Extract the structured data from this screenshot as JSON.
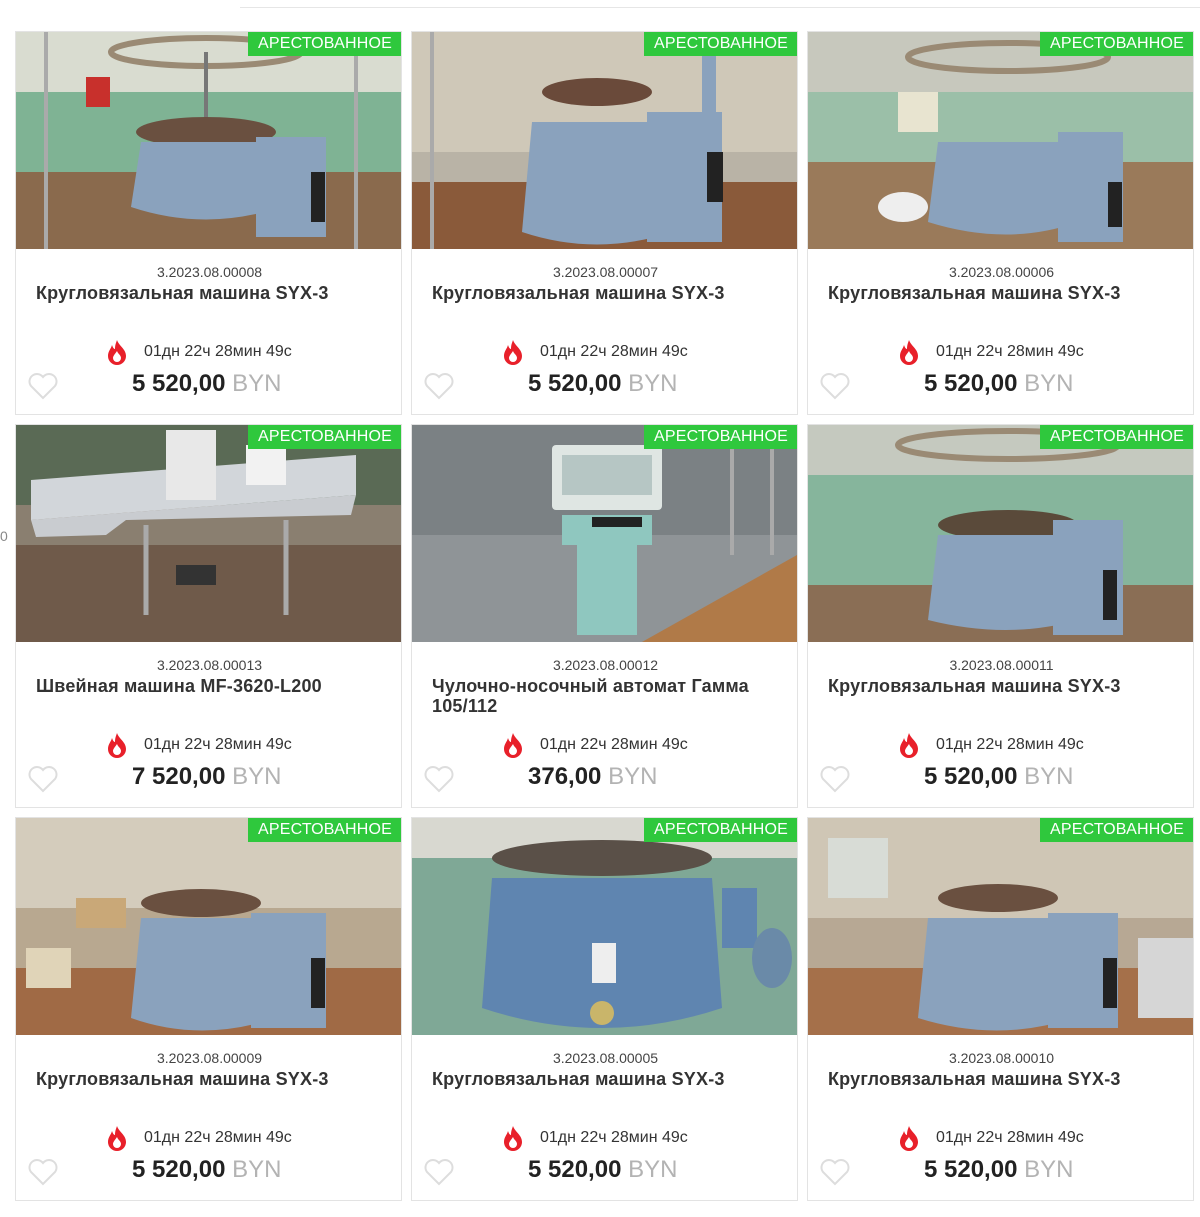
{
  "page": {
    "side_mark": "0"
  },
  "cards": [
    {
      "badge": "АРЕСТОВАННОЕ",
      "lot": "3.2023.08.00008",
      "title": "Кругловязальная машина SYX-3",
      "timer": "01дн 22ч 28мин 49с",
      "price": "5 520,00",
      "currency": "BYN",
      "photo_icon": "circular-knitting-machine"
    },
    {
      "badge": "АРЕСТОВАННОЕ",
      "lot": "3.2023.08.00007",
      "title": "Кругловязальная машина SYX-3",
      "timer": "01дн 22ч 28мин 49с",
      "price": "5 520,00",
      "currency": "BYN",
      "photo_icon": "circular-knitting-machine"
    },
    {
      "badge": "АРЕСТОВАННОЕ",
      "lot": "3.2023.08.00006",
      "title": "Кругловязальная машина SYX-3",
      "timer": "01дн 22ч 28мин 49с",
      "price": "5 520,00",
      "currency": "BYN",
      "photo_icon": "circular-knitting-machine"
    },
    {
      "badge": "АРЕСТОВАННОЕ",
      "lot": "3.2023.08.00013",
      "title": "Швейная машина MF-3620-L200",
      "timer": "01дн 22ч 28мин 49с",
      "price": "7 520,00",
      "currency": "BYN",
      "photo_icon": "sewing-machine-table"
    },
    {
      "badge": "АРЕСТОВАННОЕ",
      "lot": "3.2023.08.00012",
      "title": "Чулочно-носочный автомат Гамма 105/112",
      "timer": "01дн 22ч 28мин 49с",
      "price": "376,00",
      "currency": "BYN",
      "photo_icon": "hosiery-machine"
    },
    {
      "badge": "АРЕСТОВАННОЕ",
      "lot": "3.2023.08.00011",
      "title": "Кругловязальная машина SYX-3",
      "timer": "01дн 22ч 28мин 49с",
      "price": "5 520,00",
      "currency": "BYN",
      "photo_icon": "circular-knitting-machine"
    },
    {
      "badge": "АРЕСТОВАННОЕ",
      "lot": "3.2023.08.00009",
      "title": "Кругловязальная машина SYX-3",
      "timer": "01дн 22ч 28мин 49с",
      "price": "5 520,00",
      "currency": "BYN",
      "photo_icon": "circular-knitting-machine"
    },
    {
      "badge": "АРЕСТОВАННОЕ",
      "lot": "3.2023.08.00005",
      "title": "Кругловязальная машина SYX-3",
      "timer": "01дн 22ч 28мин 49с",
      "price": "5 520,00",
      "currency": "BYN",
      "photo_icon": "circular-knitting-machine"
    },
    {
      "badge": "АРЕСТОВАННОЕ",
      "lot": "3.2023.08.00010",
      "title": "Кругловязальная машина SYX-3",
      "timer": "01дн 22ч 28мин 49с",
      "price": "5 520,00",
      "currency": "BYN",
      "photo_icon": "circular-knitting-machine"
    }
  ],
  "colors": {
    "badge": "#2fc83d",
    "fire": "#e8202a",
    "heart": "#dddddd",
    "currency": "#b3b3b3"
  }
}
